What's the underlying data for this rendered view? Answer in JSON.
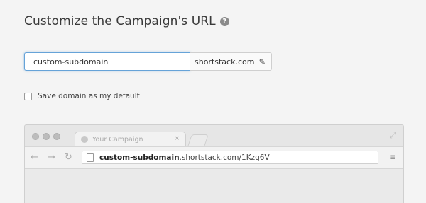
{
  "header": {
    "title": "Customize the Campaign's URL",
    "help_icon": "question-circle-icon",
    "help_glyph": "?"
  },
  "url_form": {
    "subdomain_value": "custom-subdomain",
    "domain_suffix": "shortstack.com",
    "edit_icon": "pencil-icon",
    "edit_glyph": "✎"
  },
  "default_option": {
    "label": "Save domain as my default",
    "checked": false
  },
  "browser_preview": {
    "tab_title": "Your Campaign",
    "tab_close": "×",
    "url_subdomain": "custom-subdomain",
    "url_rest": ".shortstack.com/1Kzg6V",
    "back_glyph": "←",
    "forward_glyph": "→",
    "reload_glyph": "↻",
    "menu_glyph": "≡",
    "expand_glyph": "⤢"
  },
  "colors": {
    "input_focus_border": "#66a3d8",
    "background": "#f4f4f4"
  }
}
